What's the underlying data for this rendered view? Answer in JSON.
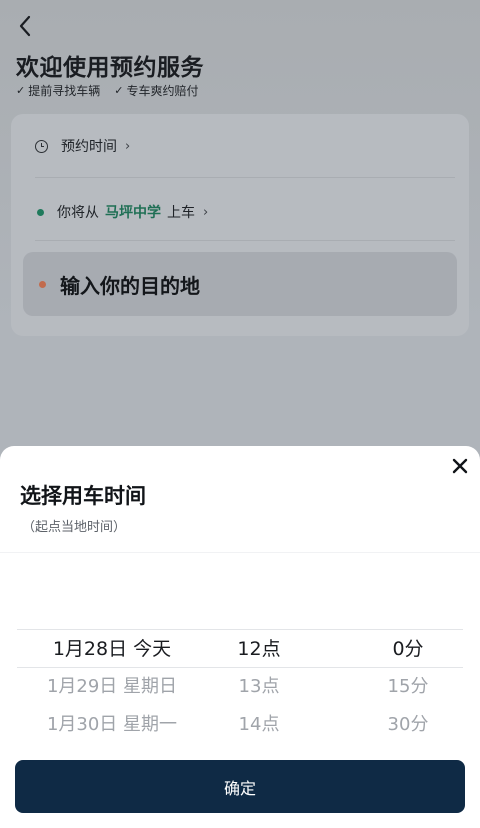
{
  "background": {
    "title": "欢迎使用预约服务",
    "tags": [
      "提前寻找车辆",
      "专车爽约赔付"
    ],
    "time_row": {
      "label": "预约时间"
    },
    "pickup_row": {
      "prefix": "你将从",
      "place": "马坪中学",
      "suffix": "上车"
    },
    "destination": {
      "placeholder": "输入你的目的地"
    }
  },
  "sheet": {
    "title": "选择用车时间",
    "subtitle": "（起点当地时间）",
    "date_options": [
      "1月28日 今天",
      "1月29日 星期日",
      "1月30日 星期一"
    ],
    "hour_options": [
      "12点",
      "13点",
      "14点"
    ],
    "minute_options": [
      "0分",
      "15分",
      "30分"
    ],
    "confirm_label": "确定"
  },
  "colors": {
    "accent": "#0f2a45",
    "green": "#1f7a5c",
    "orange_dot": "#c26b4d"
  },
  "icons": [
    "back-arrow-icon",
    "check-icon",
    "clock-icon",
    "chevron-right-icon",
    "close-icon"
  ]
}
